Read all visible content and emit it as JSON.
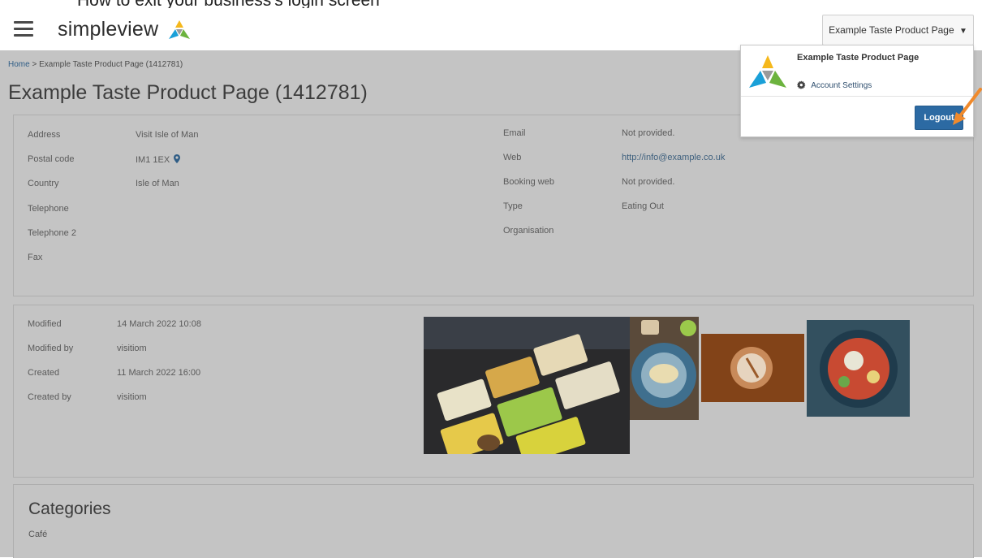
{
  "top_caption": "How to exit your business's login screen",
  "header": {
    "logo_text": "simpleview",
    "account_button": "Example Taste Product Page",
    "account_caret": "▼"
  },
  "breadcrumb": {
    "home": "Home",
    "separator": ">",
    "current": "Example Taste Product Page (1412781)"
  },
  "page_title": "Example Taste Product Page (1412781)",
  "details_left": [
    {
      "label": "Address",
      "value": "Visit Isle of Man"
    },
    {
      "label": "Postal code",
      "value": "IM1 1EX"
    },
    {
      "label": "Country",
      "value": "Isle of Man"
    },
    {
      "label": "Telephone",
      "value": ""
    },
    {
      "label": "Telephone 2",
      "value": ""
    },
    {
      "label": "Fax",
      "value": ""
    }
  ],
  "details_right": [
    {
      "label": "Email",
      "value": "Not provided."
    },
    {
      "label": "Web",
      "value": "http://info@example.co.uk"
    },
    {
      "label": "Booking web",
      "value": "Not provided."
    },
    {
      "label": "Type",
      "value": "Eating Out"
    },
    {
      "label": "Organisation",
      "value": ""
    }
  ],
  "meta": [
    {
      "label": "Modified",
      "value": "14 March 2022 10:08"
    },
    {
      "label": "Modified by",
      "value": "visitiom"
    },
    {
      "label": "Created",
      "value": "11 March 2022 16:00"
    },
    {
      "label": "Created by",
      "value": "visitiom"
    }
  ],
  "categories": {
    "title": "Categories",
    "items": [
      "Café"
    ]
  },
  "dropdown": {
    "name": "Example Taste Product Page",
    "settings": "Account Settings",
    "logout": "Logout"
  },
  "colors": {
    "page_bg": "#c4c4c4",
    "logout_bg": "#2c6aa3",
    "annotation_arrow": "#f08a2c",
    "logo_yellow": "#f5b81c",
    "logo_blue": "#1aa0d8",
    "logo_green": "#6cb33e"
  }
}
